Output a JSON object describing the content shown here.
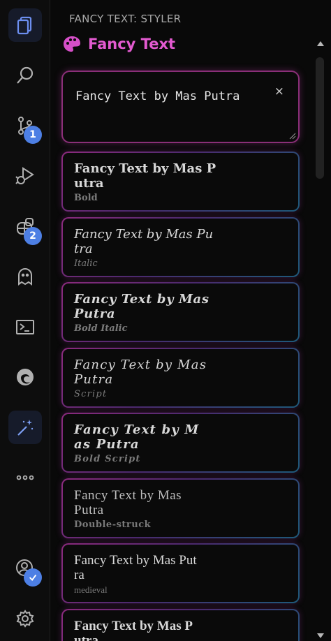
{
  "activity_bar": {
    "items": [
      {
        "name": "explorer-icon",
        "active": false
      },
      {
        "name": "search-icon",
        "active": false
      },
      {
        "name": "source-control-icon",
        "badge": "1"
      },
      {
        "name": "run-debug-icon"
      },
      {
        "name": "extensions-icon",
        "badge": "2"
      },
      {
        "name": "ghost-icon"
      },
      {
        "name": "terminal-icon"
      },
      {
        "name": "edge-browser-icon"
      },
      {
        "name": "magic-wand-icon",
        "active": true
      },
      {
        "name": "more-icon"
      },
      {
        "name": "account-icon"
      },
      {
        "name": "settings-gear-icon"
      }
    ]
  },
  "panel": {
    "header": "FANCY TEXT: STYLER",
    "title": "Fancy Text",
    "input_value": "Fancy Text by Mas Putra",
    "clear_label": "×"
  },
  "styles": [
    {
      "sample": "Fancy Text by Mas P\nutra",
      "label": "Bold"
    },
    {
      "sample": "Fancy Text by Mas Pu\ntra",
      "label": "Italic"
    },
    {
      "sample": "Fancy Text by Mas\nPutra",
      "label": "Bold Italic"
    },
    {
      "sample": "Fancy Text by Mas\nPutra",
      "label": "Script"
    },
    {
      "sample": "Fancy Text by M\nas Putra",
      "label": "Bold Script"
    },
    {
      "sample": "Fancy Text by Mas\nPutra",
      "label": "Double-struck"
    },
    {
      "sample": "Fancy Text by Mas Put\nra",
      "label": "medieval"
    },
    {
      "sample": "Fancy Text by Mas P\nutra",
      "label": ""
    }
  ],
  "colors": {
    "accent": "#e35ad0",
    "badge": "#4d7fe4",
    "icon": "#b8b8b8",
    "card_border_start": "#8b2a7d",
    "card_border_end": "#1e5a7a"
  }
}
